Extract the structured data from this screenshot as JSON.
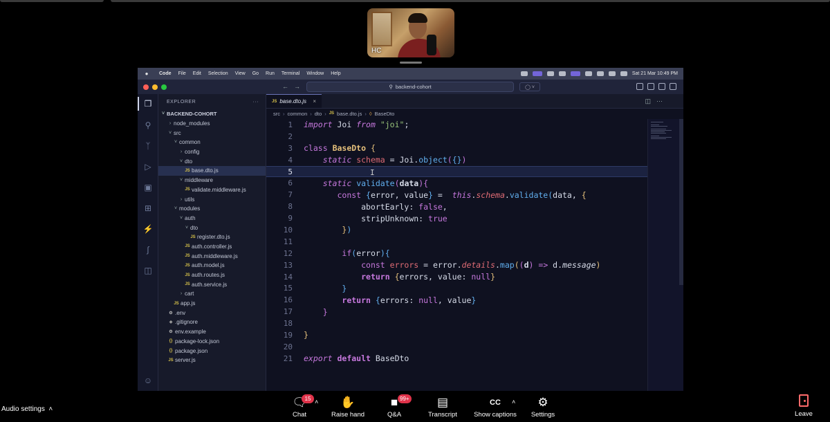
{
  "meeting": {
    "participant_initials": "HC"
  },
  "mac_menu": {
    "items": [
      "Code",
      "File",
      "Edit",
      "Selection",
      "View",
      "Go",
      "Run",
      "Terminal",
      "Window",
      "Help"
    ],
    "datetime": "Sat 21 Mar  10:49 PM"
  },
  "vscode": {
    "command_center": "backend-cohort",
    "explorer_title": "EXPLORER",
    "project_root": "BACKEND-COHORT",
    "tree": [
      {
        "label": "node_modules",
        "type": "folder",
        "expanded": false
      },
      {
        "label": "src",
        "type": "folder",
        "expanded": true
      },
      {
        "label": "common",
        "type": "folder",
        "expanded": true
      },
      {
        "label": "config",
        "type": "folder",
        "expanded": false
      },
      {
        "label": "dto",
        "type": "folder",
        "expanded": true
      },
      {
        "label": "base.dto.js",
        "type": "js",
        "selected": true
      },
      {
        "label": "middleware",
        "type": "folder",
        "expanded": true
      },
      {
        "label": "validate.middleware.js",
        "type": "js"
      },
      {
        "label": "utils",
        "type": "folder",
        "expanded": false
      },
      {
        "label": "modules",
        "type": "folder",
        "expanded": true
      },
      {
        "label": "auth",
        "type": "folder",
        "expanded": true
      },
      {
        "label": "dto",
        "type": "folder",
        "expanded": true
      },
      {
        "label": "register.dto.js",
        "type": "js"
      },
      {
        "label": "auth.controller.js",
        "type": "js"
      },
      {
        "label": "auth.middleware.js",
        "type": "js"
      },
      {
        "label": "auth.model.js",
        "type": "js"
      },
      {
        "label": "auth.routes.js",
        "type": "js"
      },
      {
        "label": "auth.service.js",
        "type": "js"
      },
      {
        "label": "cart",
        "type": "folder",
        "expanded": false
      },
      {
        "label": "app.js",
        "type": "js"
      },
      {
        "label": ".env",
        "type": "env"
      },
      {
        "label": ".gitignore",
        "type": "git"
      },
      {
        "label": "env.example",
        "type": "env"
      },
      {
        "label": "package-lock.json",
        "type": "json"
      },
      {
        "label": "package.json",
        "type": "json"
      },
      {
        "label": "server.js",
        "type": "js"
      }
    ],
    "active_tab": "base.dto.js",
    "breadcrumb": [
      "src",
      "common",
      "dto",
      "base.dto.js",
      "BaseDto"
    ],
    "current_line": 5,
    "line_count": 21
  },
  "toolbar": {
    "audio_settings": "Audio settings",
    "chat": "Chat",
    "chat_badge": "15",
    "raise_hand": "Raise hand",
    "qa": "Q&A",
    "qa_badge": "99+",
    "transcript": "Transcript",
    "show_captions": "Show captions",
    "settings": "Settings",
    "leave": "Leave"
  }
}
